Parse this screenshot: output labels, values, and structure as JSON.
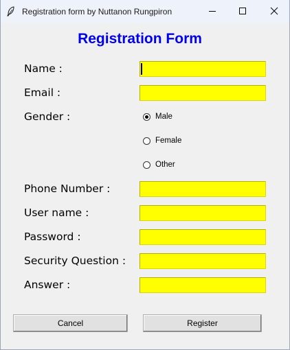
{
  "window": {
    "title": "Registration form by Nuttanon Rungpiron",
    "icons": [
      "feather-icon",
      "minimize-icon",
      "maximize-icon",
      "close-icon"
    ]
  },
  "form": {
    "title": "Registration Form",
    "name_label": "Name :",
    "name_value": "",
    "email_label": "Email :",
    "email_value": "",
    "gender_label": "Gender :",
    "gender_options": [
      "Male",
      "Female",
      "Other"
    ],
    "gender_selected": "Male",
    "phone_label": "Phone Number :",
    "phone_value": "",
    "username_label": "User name :",
    "username_value": "",
    "password_label": "Password :",
    "password_value": "",
    "security_label": "Security Question :",
    "security_value": "",
    "answer_label": "Answer :",
    "answer_value": ""
  },
  "buttons": {
    "cancel": "Cancel",
    "register": "Register"
  },
  "colors": {
    "field_background": "#ffff00",
    "title": "#0000ee"
  }
}
